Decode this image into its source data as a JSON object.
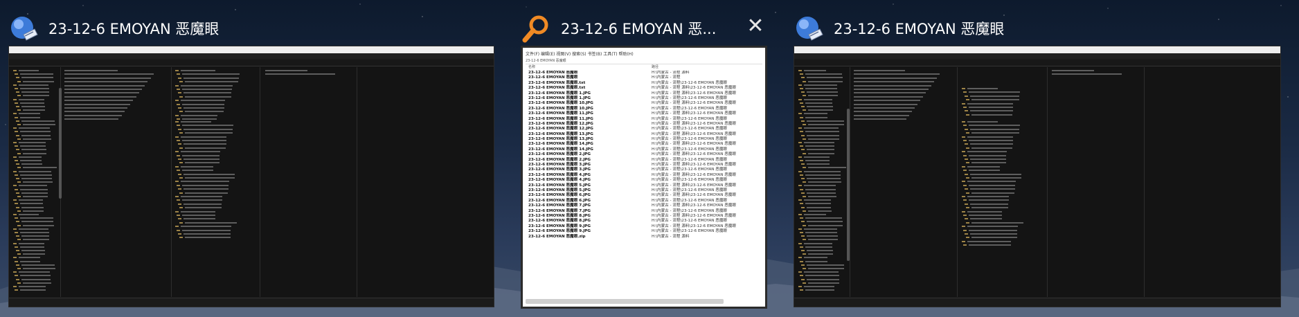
{
  "windows": [
    {
      "id": "left",
      "title": "23-12-6 EMOYAN 恶魔眼",
      "icon": "explorer-app-icon"
    },
    {
      "id": "center",
      "title": "23-12-6 EMOYAN 恶...",
      "icon": "search-magnifier-icon",
      "close_label": "✕",
      "menu": "文件(F)  编辑(E)  视图(V)  搜索(S)  书签(B)  工具(T)  帮助(H)",
      "path": "23-12-6 EMOYAN 恶魔眼",
      "columns": {
        "name": "名称",
        "path": "路径"
      },
      "rows": [
        {
          "name": "23-12-6 EMOYAN 恶魔眼",
          "path": "H:\\内蒙古 - 流程 源料"
        },
        {
          "name": "23-12-6 EMOYAN 恶魔眼",
          "path": "H:\\内蒙古 - 流程"
        },
        {
          "name": "23-12-6 EMOYAN 恶魔眼.txt",
          "path": "H:\\内蒙古 - 流程\\23-12-6 EMOYAN 恶魔眼"
        },
        {
          "name": "23-12-6 EMOYAN 恶魔眼.txt",
          "path": "H:\\内蒙古 - 流程 源料\\23-12-6 EMOYAN 恶魔眼"
        },
        {
          "name": "23-12-6 EMOYAN 恶魔眼 1.JPG",
          "path": "H:\\内蒙古 - 流程 源料\\23-12-6 EMOYAN 恶魔眼"
        },
        {
          "name": "23-12-6 EMOYAN 恶魔眼 1.JPG",
          "path": "H:\\内蒙古 - 流程\\23-12-6 EMOYAN 恶魔眼"
        },
        {
          "name": "23-12-6 EMOYAN 恶魔眼 10.JPG",
          "path": "H:\\内蒙古 - 流程 源料\\23-12-6 EMOYAN 恶魔眼"
        },
        {
          "name": "23-12-6 EMOYAN 恶魔眼 10.JPG",
          "path": "H:\\内蒙古 - 流程\\23-12-6 EMOYAN 恶魔眼"
        },
        {
          "name": "23-12-6 EMOYAN 恶魔眼 11.JPG",
          "path": "H:\\内蒙古 - 流程 源料\\23-12-6 EMOYAN 恶魔眼"
        },
        {
          "name": "23-12-6 EMOYAN 恶魔眼 11.JPG",
          "path": "H:\\内蒙古 - 流程\\23-12-6 EMOYAN 恶魔眼"
        },
        {
          "name": "23-12-6 EMOYAN 恶魔眼 12.JPG",
          "path": "H:\\内蒙古 - 流程 源料\\23-12-6 EMOYAN 恶魔眼"
        },
        {
          "name": "23-12-6 EMOYAN 恶魔眼 12.JPG",
          "path": "H:\\内蒙古 - 流程\\23-12-6 EMOYAN 恶魔眼"
        },
        {
          "name": "23-12-6 EMOYAN 恶魔眼 13.JPG",
          "path": "H:\\内蒙古 - 流程 源料\\23-12-6 EMOYAN 恶魔眼"
        },
        {
          "name": "23-12-6 EMOYAN 恶魔眼 13.JPG",
          "path": "H:\\内蒙古 - 流程\\23-12-6 EMOYAN 恶魔眼"
        },
        {
          "name": "23-12-6 EMOYAN 恶魔眼 14.JPG",
          "path": "H:\\内蒙古 - 流程 源料\\23-12-6 EMOYAN 恶魔眼"
        },
        {
          "name": "23-12-6 EMOYAN 恶魔眼 14.JPG",
          "path": "H:\\内蒙古 - 流程\\23-12-6 EMOYAN 恶魔眼"
        },
        {
          "name": "23-12-6 EMOYAN 恶魔眼 2.JPG",
          "path": "H:\\内蒙古 - 流程 源料\\23-12-6 EMOYAN 恶魔眼"
        },
        {
          "name": "23-12-6 EMOYAN 恶魔眼 2.JPG",
          "path": "H:\\内蒙古 - 流程\\23-12-6 EMOYAN 恶魔眼"
        },
        {
          "name": "23-12-6 EMOYAN 恶魔眼 3.JPG",
          "path": "H:\\内蒙古 - 流程 源料\\23-12-6 EMOYAN 恶魔眼"
        },
        {
          "name": "23-12-6 EMOYAN 恶魔眼 3.JPG",
          "path": "H:\\内蒙古 - 流程\\23-12-6 EMOYAN 恶魔眼"
        },
        {
          "name": "23-12-6 EMOYAN 恶魔眼 4.JPG",
          "path": "H:\\内蒙古 - 流程 源料\\23-12-6 EMOYAN 恶魔眼"
        },
        {
          "name": "23-12-6 EMOYAN 恶魔眼 4.JPG",
          "path": "H:\\内蒙古 - 流程\\23-12-6 EMOYAN 恶魔眼"
        },
        {
          "name": "23-12-6 EMOYAN 恶魔眼 5.JPG",
          "path": "H:\\内蒙古 - 流程 源料\\23-12-6 EMOYAN 恶魔眼"
        },
        {
          "name": "23-12-6 EMOYAN 恶魔眼 5.JPG",
          "path": "H:\\内蒙古 - 流程\\23-12-6 EMOYAN 恶魔眼"
        },
        {
          "name": "23-12-6 EMOYAN 恶魔眼 6.JPG",
          "path": "H:\\内蒙古 - 流程 源料\\23-12-6 EMOYAN 恶魔眼"
        },
        {
          "name": "23-12-6 EMOYAN 恶魔眼 6.JPG",
          "path": "H:\\内蒙古 - 流程\\23-12-6 EMOYAN 恶魔眼"
        },
        {
          "name": "23-12-6 EMOYAN 恶魔眼 7.JPG",
          "path": "H:\\内蒙古 - 流程 源料\\23-12-6 EMOYAN 恶魔眼"
        },
        {
          "name": "23-12-6 EMOYAN 恶魔眼 7.JPG",
          "path": "H:\\内蒙古 - 流程\\23-12-6 EMOYAN 恶魔眼"
        },
        {
          "name": "23-12-6 EMOYAN 恶魔眼 8.JPG",
          "path": "H:\\内蒙古 - 流程 源料\\23-12-6 EMOYAN 恶魔眼"
        },
        {
          "name": "23-12-6 EMOYAN 恶魔眼 8.JPG",
          "path": "H:\\内蒙古 - 流程\\23-12-6 EMOYAN 恶魔眼"
        },
        {
          "name": "23-12-6 EMOYAN 恶魔眼 9.JPG",
          "path": "H:\\内蒙古 - 流程 源料\\23-12-6 EMOYAN 恶魔眼"
        },
        {
          "name": "23-12-6 EMOYAN 恶魔眼 9.JPG",
          "path": "H:\\内蒙古 - 流程\\23-12-6 EMOYAN 恶魔眼"
        },
        {
          "name": "23-12-6 EMOYAN 恶魔眼.zip",
          "path": "H:\\内蒙古 - 流程 源料"
        }
      ]
    },
    {
      "id": "right",
      "title": "23-12-6 EMOYAN 恶魔眼",
      "icon": "explorer-app-icon"
    }
  ],
  "colors": {
    "accent": "#f08a24",
    "desktop_top": "#0d1a2d",
    "desktop_bottom": "#384a66"
  }
}
